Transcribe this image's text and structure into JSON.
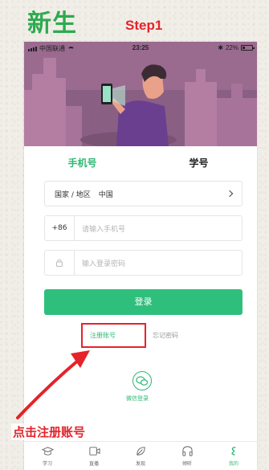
{
  "header": {
    "title": "新生",
    "step": "Step1"
  },
  "status_bar": {
    "carrier": "中国联通",
    "time": "23:25",
    "battery": "22%"
  },
  "login": {
    "tabs": [
      {
        "label": "手机号",
        "active": true
      },
      {
        "label": "学号",
        "active": false
      }
    ],
    "country_label": "国家 / 地区",
    "country_value": "中国",
    "country_code": "+86",
    "phone_placeholder": "请输入手机号",
    "password_placeholder": "输入登录密码",
    "login_button": "登录",
    "register_link": "注册账号",
    "forgot_link": "忘记密码",
    "wechat_login": "微信登录"
  },
  "bottom_nav": {
    "items": [
      {
        "label": "学习",
        "icon": "graduation-cap-icon"
      },
      {
        "label": "直播",
        "icon": "video-icon"
      },
      {
        "label": "发现",
        "icon": "leaf-icon"
      },
      {
        "label": "倾听",
        "icon": "headphones-icon"
      },
      {
        "label": "我的",
        "icon": "user-icon",
        "active": true
      }
    ]
  },
  "annotation": {
    "text": "点击注册账号"
  },
  "colors": {
    "brand_green": "#2eb873",
    "annotation_red": "#e4232a",
    "banner_purple": "#8a5f84"
  }
}
